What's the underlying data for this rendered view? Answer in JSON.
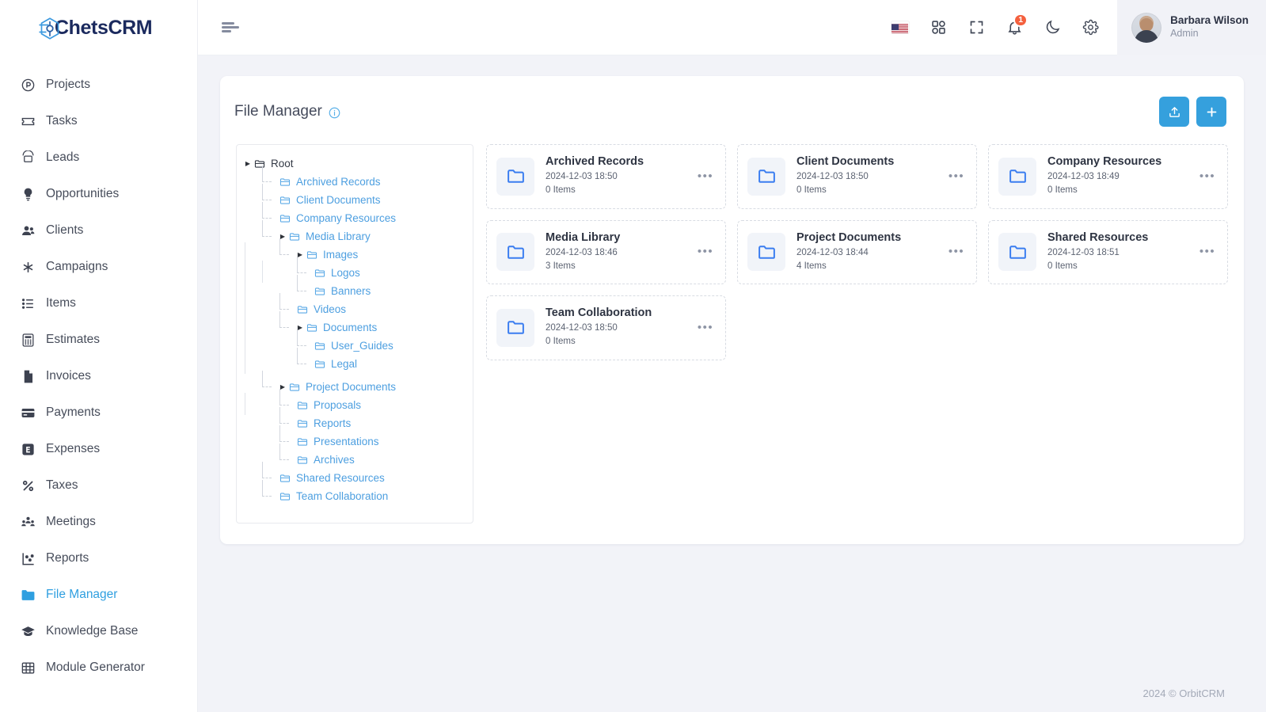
{
  "brand": {
    "name": "ChetsCRM",
    "accent": "#35a0dd",
    "logo_icon": "crm-logo-icon"
  },
  "sidebar": {
    "items": [
      {
        "label": "Projects",
        "icon": "projects-circle-p-icon",
        "active": false
      },
      {
        "label": "Tasks",
        "icon": "ticket-icon",
        "active": false
      },
      {
        "label": "Leads",
        "icon": "telephone-icon",
        "active": false
      },
      {
        "label": "Opportunities",
        "icon": "lightbulb-icon",
        "active": false
      },
      {
        "label": "Clients",
        "icon": "users-icon",
        "active": false
      },
      {
        "label": "Campaigns",
        "icon": "asterisk-icon",
        "active": false
      },
      {
        "label": "Items",
        "icon": "list-icon",
        "active": false
      },
      {
        "label": "Estimates",
        "icon": "calculator-icon",
        "active": false
      },
      {
        "label": "Invoices",
        "icon": "file-icon",
        "active": false
      },
      {
        "label": "Payments",
        "icon": "credit-card-icon",
        "active": false
      },
      {
        "label": "Expenses",
        "icon": "square-e-icon",
        "active": false
      },
      {
        "label": "Taxes",
        "icon": "percent-icon",
        "active": false
      },
      {
        "label": "Meetings",
        "icon": "people-group-icon",
        "active": false
      },
      {
        "label": "Reports",
        "icon": "chart-scatter-icon",
        "active": false
      },
      {
        "label": "File Manager",
        "icon": "folder-icon",
        "active": true
      },
      {
        "label": "Knowledge Base",
        "icon": "graduation-cap-icon",
        "active": false
      },
      {
        "label": "Module Generator",
        "icon": "grid-table-icon",
        "active": false
      }
    ]
  },
  "topbar": {
    "menu_toggle": "sidebar-toggle",
    "icons": [
      {
        "name": "language-flag-us-icon",
        "label": "US"
      },
      {
        "name": "apps-grid-icon",
        "label": "Apps"
      },
      {
        "name": "fullscreen-icon",
        "label": "Fullscreen"
      },
      {
        "name": "notifications-bell-icon",
        "label": "Notifications",
        "badge": "1"
      },
      {
        "name": "dark-mode-moon-icon",
        "label": "Dark mode"
      },
      {
        "name": "settings-gear-icon",
        "label": "Settings"
      }
    ],
    "notification_count": "1",
    "user": {
      "name": "Barbara Wilson",
      "role": "Admin"
    }
  },
  "page": {
    "title": "File Manager",
    "info_icon": "info-icon",
    "actions": [
      {
        "name": "upload-button",
        "icon": "upload-icon"
      },
      {
        "name": "add-folder-button",
        "icon": "plus-icon"
      }
    ]
  },
  "tree": [
    {
      "label": "Root",
      "depth": 0,
      "caret": "collapsed",
      "root": true
    },
    {
      "label": "Archived Records",
      "depth": 1,
      "caret": "none"
    },
    {
      "label": "Client Documents",
      "depth": 1,
      "caret": "none"
    },
    {
      "label": "Company Resources",
      "depth": 1,
      "caret": "none"
    },
    {
      "label": "Media Library",
      "depth": 1,
      "caret": "collapsed"
    },
    {
      "label": "Images",
      "depth": 2,
      "caret": "collapsed"
    },
    {
      "label": "Logos",
      "depth": 3,
      "caret": "none"
    },
    {
      "label": "Banners",
      "depth": 3,
      "caret": "none"
    },
    {
      "label": "Videos",
      "depth": 2,
      "caret": "none"
    },
    {
      "label": "Documents",
      "depth": 2,
      "caret": "collapsed"
    },
    {
      "label": "User_Guides",
      "depth": 3,
      "caret": "none"
    },
    {
      "label": "Legal",
      "depth": 3,
      "caret": "none"
    },
    {
      "label": "Project Documents",
      "depth": 1,
      "caret": "collapsed"
    },
    {
      "label": "Proposals",
      "depth": 2,
      "caret": "none"
    },
    {
      "label": "Reports",
      "depth": 2,
      "caret": "none"
    },
    {
      "label": "Presentations",
      "depth": 2,
      "caret": "none"
    },
    {
      "label": "Archives",
      "depth": 2,
      "caret": "none"
    },
    {
      "label": "Shared Resources",
      "depth": 1,
      "caret": "none"
    },
    {
      "label": "Team Collaboration",
      "depth": 1,
      "caret": "none"
    }
  ],
  "folders": [
    {
      "name": "Archived Records",
      "date": "2024-12-03 18:50",
      "items": "0 Items"
    },
    {
      "name": "Client Documents",
      "date": "2024-12-03 18:50",
      "items": "0 Items"
    },
    {
      "name": "Company Resources",
      "date": "2024-12-03 18:49",
      "items": "0 Items"
    },
    {
      "name": "Media Library",
      "date": "2024-12-03 18:46",
      "items": "3 Items"
    },
    {
      "name": "Project Documents",
      "date": "2024-12-03 18:44",
      "items": "4 Items"
    },
    {
      "name": "Shared Resources",
      "date": "2024-12-03 18:51",
      "items": "0 Items"
    },
    {
      "name": "Team Collaboration",
      "date": "2024-12-03 18:50",
      "items": "0 Items"
    }
  ],
  "footer": {
    "text": "2024 © OrbitCRM"
  }
}
